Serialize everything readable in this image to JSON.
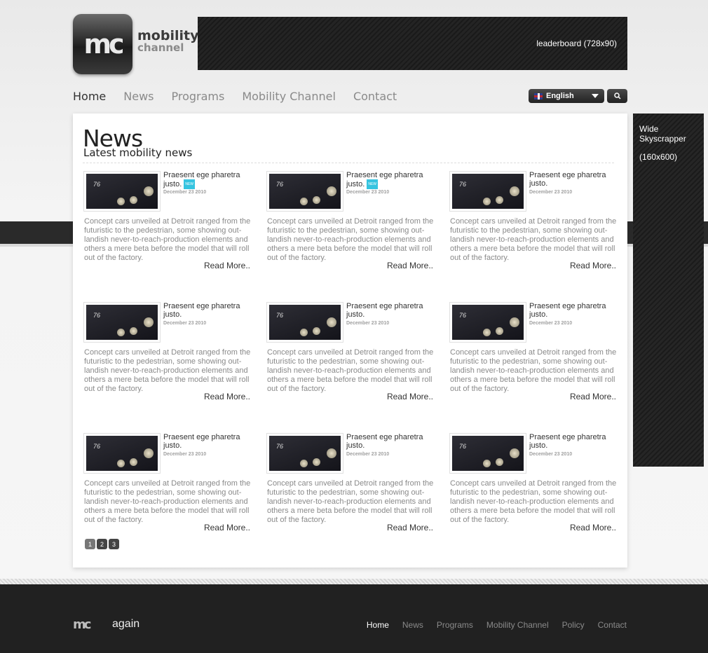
{
  "header": {
    "logo_mark": "mc",
    "logo_line1": "mobility",
    "logo_line2": "channel",
    "leaderboard_label": "leaderboard  (728x90)"
  },
  "nav": {
    "items": [
      {
        "label": "Home",
        "active": true
      },
      {
        "label": "News",
        "active": false
      },
      {
        "label": "Programs",
        "active": false
      },
      {
        "label": "Mobility Channel",
        "active": false
      },
      {
        "label": "Contact",
        "active": false
      }
    ],
    "language": "English",
    "search_icon": "magnifier-icon"
  },
  "skyscraper": {
    "line1": "Wide Skyscrapper",
    "line2": "(160x600)"
  },
  "main": {
    "title": "News",
    "subtitle": "Latest mobility news",
    "articles": [
      {
        "title": "Praesent ege pharetra justo.",
        "badge": "NEW",
        "date": "December 23 2010",
        "body": "Concept cars unveiled at Detroit ranged from the futuristic to the pedestrian, some showing out-landish never-to-reach-production elements and others a mere beta before the model that will roll out of the factory.",
        "read_more": "Read More.."
      },
      {
        "title": "Praesent ege pharetra justo.",
        "badge": "NEW",
        "date": "December 23 2010",
        "body": "Concept cars unveiled at Detroit ranged from the futuristic to the pedestrian, some showing out-landish never-to-reach-production elements and others a mere beta before the model that will roll out of the factory.",
        "read_more": "Read More.."
      },
      {
        "title": "Praesent ege pharetra justo.",
        "badge": "",
        "date": "December 23 2010",
        "body": "Concept cars unveiled at Detroit ranged from the futuristic to the pedestrian, some showing out-landish never-to-reach-production elements and others a mere beta before the model that will roll out of the factory.",
        "read_more": "Read More.."
      },
      {
        "title": "Praesent ege pharetra justo.",
        "badge": "",
        "date": "December 23 2010",
        "body": "Concept cars unveiled at Detroit ranged from the futuristic to the pedestrian, some showing out-landish never-to-reach-production elements and others a mere beta before the model that will roll out of the factory.",
        "read_more": "Read More.."
      },
      {
        "title": "Praesent ege pharetra justo.",
        "badge": "",
        "date": "December 23 2010",
        "body": "Concept cars unveiled at Detroit ranged from the futuristic to the pedestrian, some showing out-landish never-to-reach-production elements and others a mere beta before the model that will roll out of the factory.",
        "read_more": "Read More.."
      },
      {
        "title": "Praesent ege pharetra justo.",
        "badge": "",
        "date": "December 23 2010",
        "body": "Concept cars unveiled at Detroit ranged from the futuristic to the pedestrian, some showing out-landish never-to-reach-production elements and others a mere beta before the model that will roll out of the factory.",
        "read_more": "Read More.."
      },
      {
        "title": "Praesent ege pharetra justo.",
        "badge": "",
        "date": "December 23 2010",
        "body": "Concept cars unveiled at Detroit ranged from the futuristic to the pedestrian, some showing out-landish never-to-reach-production elements and others a mere beta before the model that will roll out of the factory.",
        "read_more": "Read More.."
      },
      {
        "title": "Praesent ege pharetra justo.",
        "badge": "",
        "date": "December 23 2010",
        "body": "Concept cars unveiled at Detroit ranged from the futuristic to the pedestrian, some showing out-landish never-to-reach-production elements and others a mere beta before the model that will roll out of the factory.",
        "read_more": "Read More.."
      },
      {
        "title": "Praesent ege pharetra justo.",
        "badge": "",
        "date": "December 23 2010",
        "body": "Concept cars unveiled at Detroit ranged from the futuristic to the pedestrian, some showing out-landish never-to-reach-production elements and others a mere beta before the model that will roll out of the factory.",
        "read_more": "Read More.."
      }
    ],
    "pagination": [
      "1",
      "2",
      "3"
    ],
    "current_page": "1"
  },
  "footer": {
    "logo_mark": "mc",
    "logo_again": "again",
    "nav": [
      {
        "label": "Home",
        "active": true
      },
      {
        "label": "News",
        "active": false
      },
      {
        "label": "Programs",
        "active": false
      },
      {
        "label": "Mobility Channel",
        "active": false
      },
      {
        "label": "Policy",
        "active": false
      },
      {
        "label": "Contact",
        "active": false
      }
    ]
  }
}
